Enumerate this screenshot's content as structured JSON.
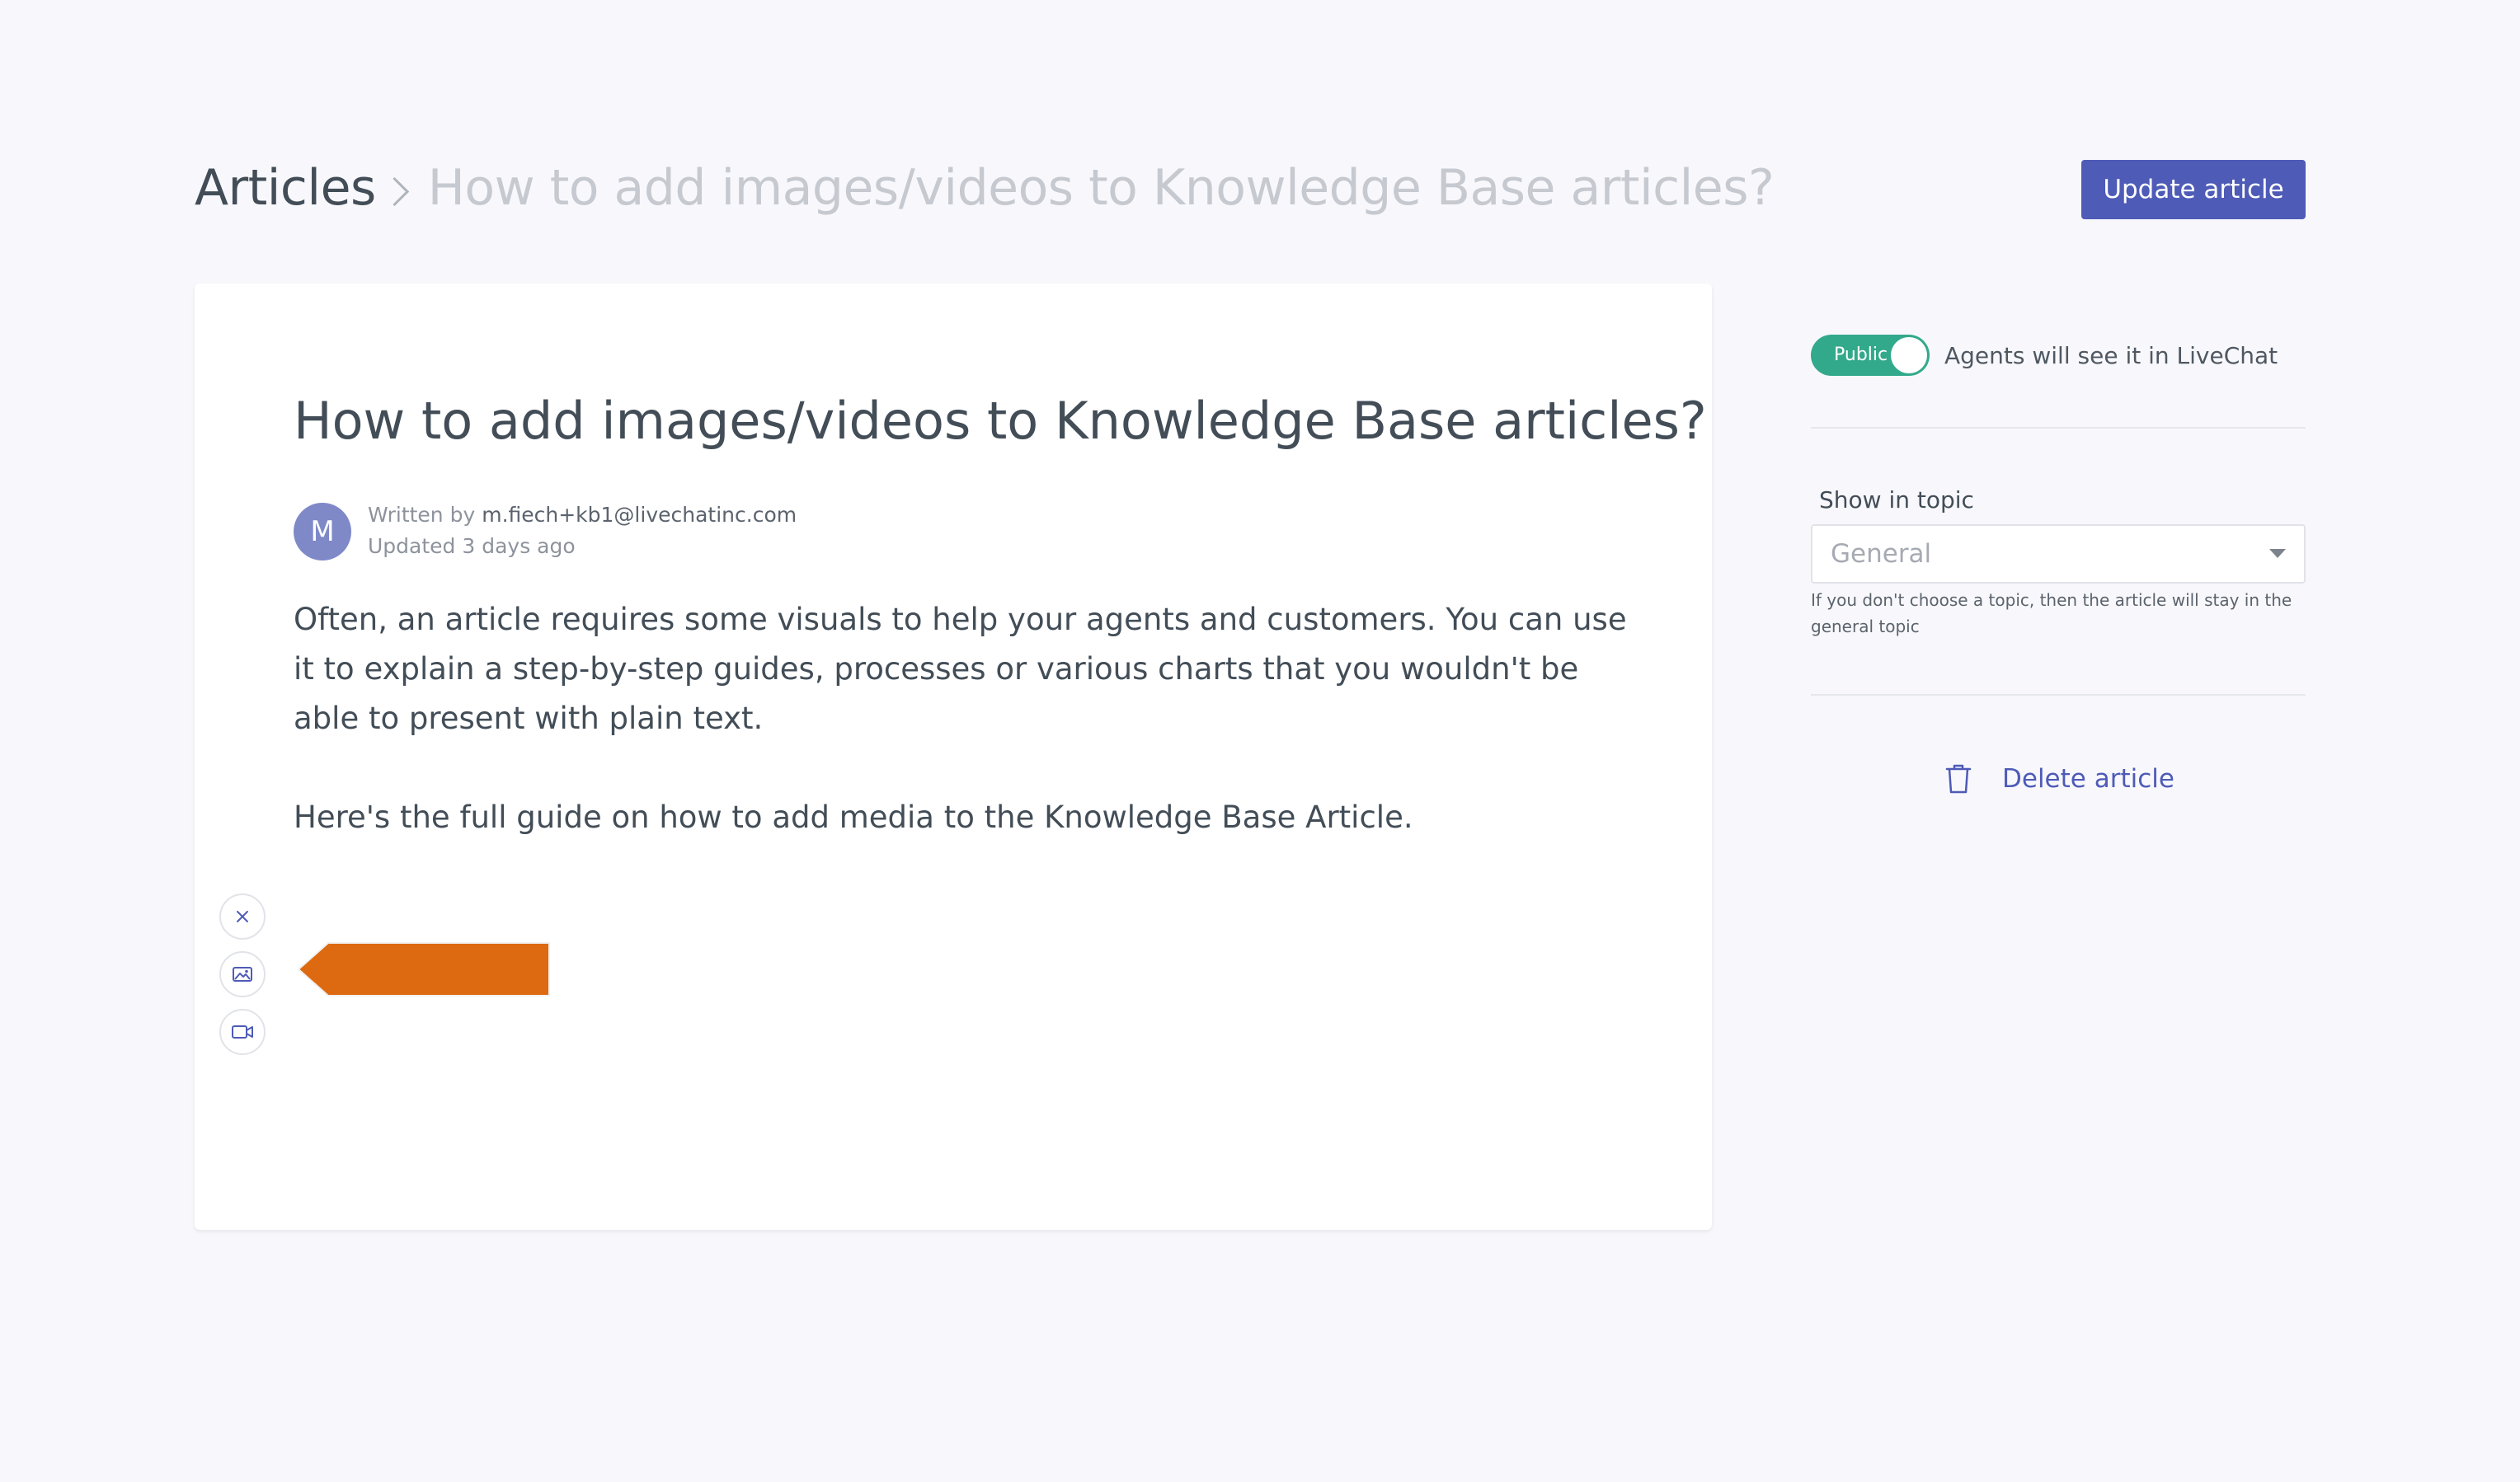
{
  "header": {
    "breadcrumb_root": "Articles",
    "breadcrumb_current": "How to add images/videos to Knowledge Base articles?",
    "update_button_label": "Update article"
  },
  "article": {
    "title": "How to add images/videos to Knowledge Base articles?",
    "avatar_initial": "M",
    "written_by_prefix": "Written by",
    "author": "m.fiech+kb1@livechatinc.com",
    "updated": "Updated 3 days ago",
    "paragraphs": [
      "Often, an article requires some visuals to help your agents and customers. You can use it to explain a step-by-step guides, processes or various charts that you wouldn't be able to present with plain text.",
      "Here's the full guide on how to add media to the Knowledge Base Article."
    ]
  },
  "media_tools": {
    "icons": [
      "close-icon",
      "image-icon",
      "video-icon"
    ]
  },
  "sidebar": {
    "visibility_toggle_label": "Public",
    "visibility_toggle_on": true,
    "visibility_description": "Agents will see it in LiveChat",
    "topic_label": "Show in topic",
    "topic_selected": "General",
    "topic_hint": "If you don't choose a topic, then the article will stay in the general topic",
    "delete_label": "Delete article"
  },
  "colors": {
    "background": "#f8f8fc",
    "primary": "#4e5bb7",
    "toggle_on": "#32a98b",
    "avatar": "#7f89c8",
    "annotation_arrow": "#dd6a10",
    "text": "#424d57"
  }
}
